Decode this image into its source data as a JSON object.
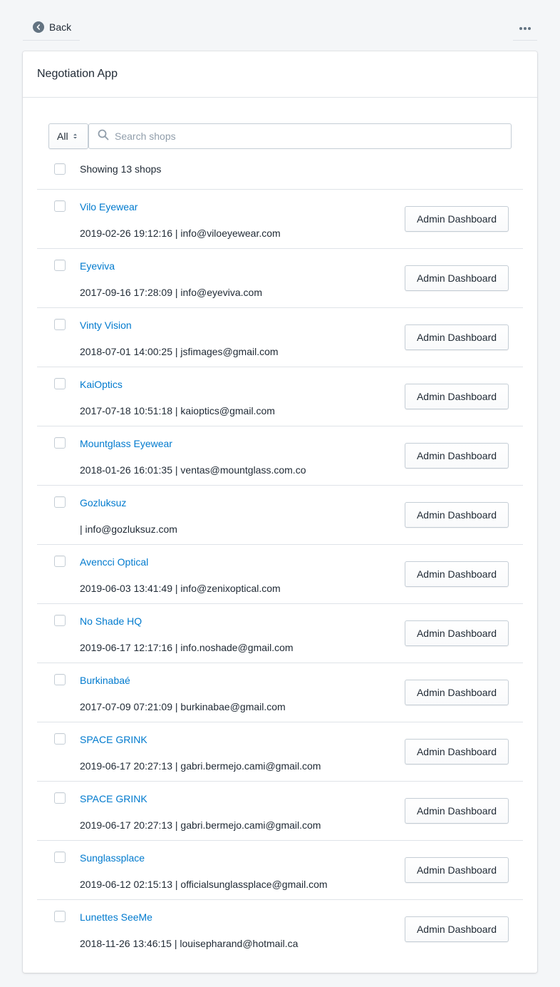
{
  "topbar": {
    "back_label": "Back",
    "back_icon": "chevron-left-circle-icon",
    "more_icon": "horizontal-dots-icon"
  },
  "card": {
    "title": "Negotiation App"
  },
  "filter": {
    "select_value": "All",
    "search_placeholder": "Search shops",
    "search_icon": "search-icon"
  },
  "summary": {
    "showing_label": "Showing 13 shops"
  },
  "colors": {
    "link": "#007ace",
    "text": "#212b36",
    "background": "#f4f6f8",
    "border": "#c4cdd5"
  },
  "shops": [
    {
      "name": "Vilo Eyewear",
      "meta": "2019-02-26 19:12:16 | info@viloeyewear.com",
      "button": "Admin Dashboard"
    },
    {
      "name": "Eyeviva",
      "meta": "2017-09-16 17:28:09 | info@eyeviva.com",
      "button": "Admin Dashboard"
    },
    {
      "name": "Vinty Vision",
      "meta": "2018-07-01 14:00:25 | jsfimages@gmail.com",
      "button": "Admin Dashboard"
    },
    {
      "name": "KaiOptics",
      "meta": "2017-07-18 10:51:18 | kaioptics@gmail.com",
      "button": "Admin Dashboard"
    },
    {
      "name": "Mountglass Eyewear",
      "meta": "2018-01-26 16:01:35 | ventas@mountglass.com.co",
      "button": "Admin Dashboard"
    },
    {
      "name": "Gozluksuz",
      "meta": "| info@gozluksuz.com",
      "button": "Admin Dashboard"
    },
    {
      "name": "Avencci Optical",
      "meta": "2019-06-03 13:41:49 | info@zenixoptical.com",
      "button": "Admin Dashboard"
    },
    {
      "name": "No Shade HQ",
      "meta": "2019-06-17 12:17:16 | info.noshade@gmail.com",
      "button": "Admin Dashboard"
    },
    {
      "name": "Burkinabaé",
      "meta": "2017-07-09 07:21:09 | burkinabae@gmail.com",
      "button": "Admin Dashboard"
    },
    {
      "name": "SPACE GRINK",
      "meta": "2019-06-17 20:27:13 | gabri.bermejo.cami@gmail.com",
      "button": "Admin Dashboard"
    },
    {
      "name": "SPACE GRINK",
      "meta": "2019-06-17 20:27:13 | gabri.bermejo.cami@gmail.com",
      "button": "Admin Dashboard"
    },
    {
      "name": "Sunglassplace",
      "meta": "2019-06-12 02:15:13 | officialsunglassplace@gmail.com",
      "button": "Admin Dashboard"
    },
    {
      "name": "Lunettes SeeMe",
      "meta": "2018-11-26 13:46:15 | louisepharand@hotmail.ca",
      "button": "Admin Dashboard"
    }
  ]
}
